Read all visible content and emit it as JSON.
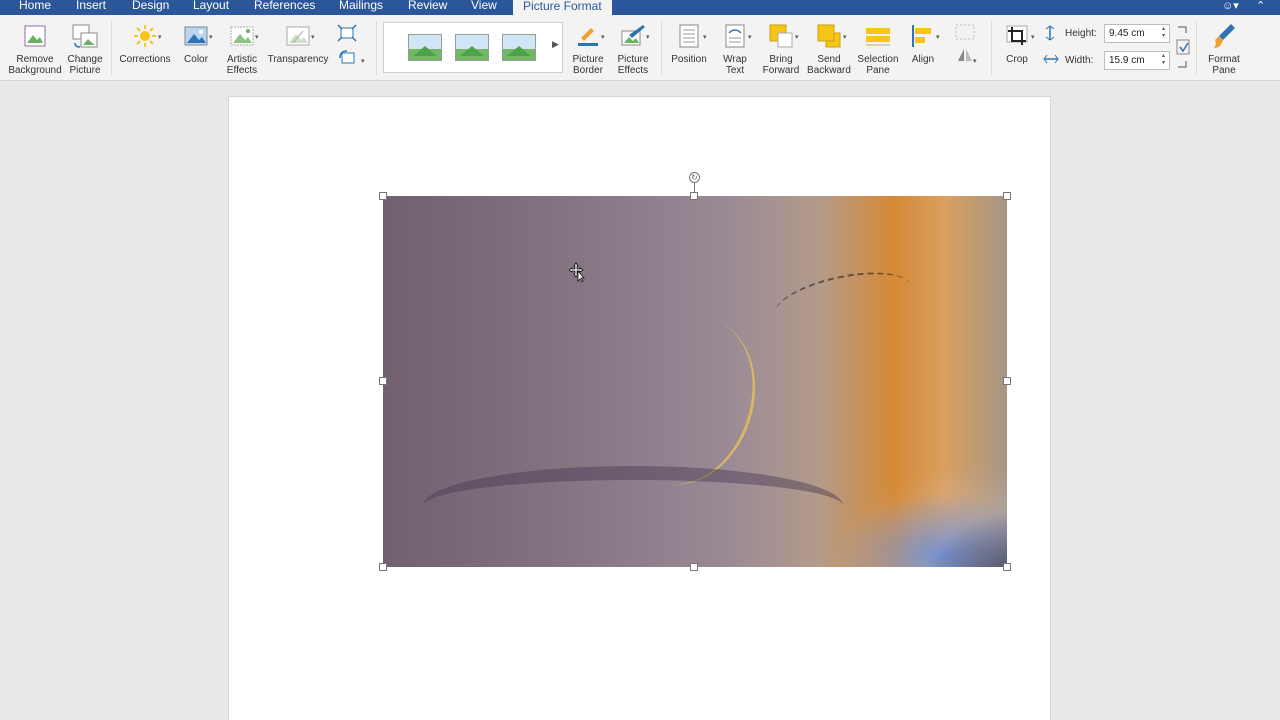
{
  "tabs": [
    {
      "label": "Home"
    },
    {
      "label": "Insert"
    },
    {
      "label": "Design"
    },
    {
      "label": "Layout"
    },
    {
      "label": "References"
    },
    {
      "label": "Mailings"
    },
    {
      "label": "Review"
    },
    {
      "label": "View"
    },
    {
      "label": "Picture Format",
      "active": true
    }
  ],
  "ribbon": {
    "remove_background": "Remove\nBackground",
    "change_picture": "Change\nPicture",
    "corrections": "Corrections",
    "color": "Color",
    "artistic_effects": "Artistic\nEffects",
    "transparency": "Transparency",
    "picture_border": "Picture\nBorder",
    "picture_effects": "Picture\nEffects",
    "position": "Position",
    "wrap_text": "Wrap\nText",
    "bring_forward": "Bring\nForward",
    "send_backward": "Send\nBackward",
    "selection_pane": "Selection\nPane",
    "align": "Align",
    "crop": "Crop",
    "height_label": "Height:",
    "height_value": "9.45 cm",
    "width_label": "Width:",
    "width_value": "15.9 cm",
    "format_pane": "Format\nPane"
  },
  "colors": {
    "tab_bar": "#2b579a",
    "ribbon_bg": "#f3f3f3",
    "canvas_bg": "#e9e9e9",
    "page_bg": "#ffffff"
  },
  "icons": [
    "smiley-icon",
    "collapse-ribbon-icon",
    "rotate-icon",
    "move-cursor-icon"
  ]
}
